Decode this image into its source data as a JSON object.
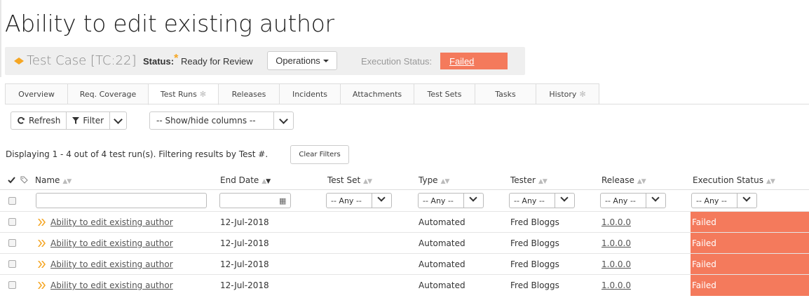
{
  "page": {
    "title": "Ability to edit existing author"
  },
  "test_case": {
    "label": "Test Case [TC:22]",
    "status_label": "Status:",
    "status_required": "*",
    "status_value": "Ready for Review",
    "operations_label": "Operations",
    "execution_status_label": "Execution Status:",
    "execution_status_value": "Failed",
    "execution_status_color": "#f47a5c"
  },
  "tabs": [
    {
      "label": "Overview"
    },
    {
      "label": "Req. Coverage"
    },
    {
      "label": "Test Runs",
      "active": true,
      "icon": "gear-icon"
    },
    {
      "label": "Releases"
    },
    {
      "label": "Incidents"
    },
    {
      "label": "Attachments"
    },
    {
      "label": "Test Sets"
    },
    {
      "label": "Tasks"
    },
    {
      "label": "History",
      "icon": "gear-icon"
    }
  ],
  "toolbar": {
    "refresh_label": "Refresh",
    "filter_label": "Filter",
    "columns_placeholder": "-- Show/hide columns --"
  },
  "results": {
    "summary": "Displaying 1 - 4 out of 4 test run(s). Filtering results by Test #.",
    "clear_filters_label": "Clear Filters"
  },
  "table": {
    "columns": {
      "name": "Name",
      "end_date": "End Date",
      "test_set": "Test Set",
      "type": "Type",
      "tester": "Tester",
      "release": "Release",
      "execution_status": "Execution Status"
    },
    "filter_any": "-- Any --",
    "rows": [
      {
        "name": "Ability to edit existing author",
        "end_date": "12-Jul-2018",
        "test_set": "",
        "type": "Automated",
        "tester": "Fred Bloggs",
        "release": "1.0.0.0",
        "status": "Failed"
      },
      {
        "name": "Ability to edit existing author",
        "end_date": "12-Jul-2018",
        "test_set": "",
        "type": "Automated",
        "tester": "Fred Bloggs",
        "release": "1.0.0.0",
        "status": "Failed"
      },
      {
        "name": "Ability to edit existing author",
        "end_date": "12-Jul-2018",
        "test_set": "",
        "type": "Automated",
        "tester": "Fred Bloggs",
        "release": "1.0.0.0",
        "status": "Failed"
      },
      {
        "name": "Ability to edit existing author",
        "end_date": "12-Jul-2018",
        "test_set": "",
        "type": "Automated",
        "tester": "Fred Bloggs",
        "release": "1.0.0.0",
        "status": "Failed"
      }
    ]
  }
}
